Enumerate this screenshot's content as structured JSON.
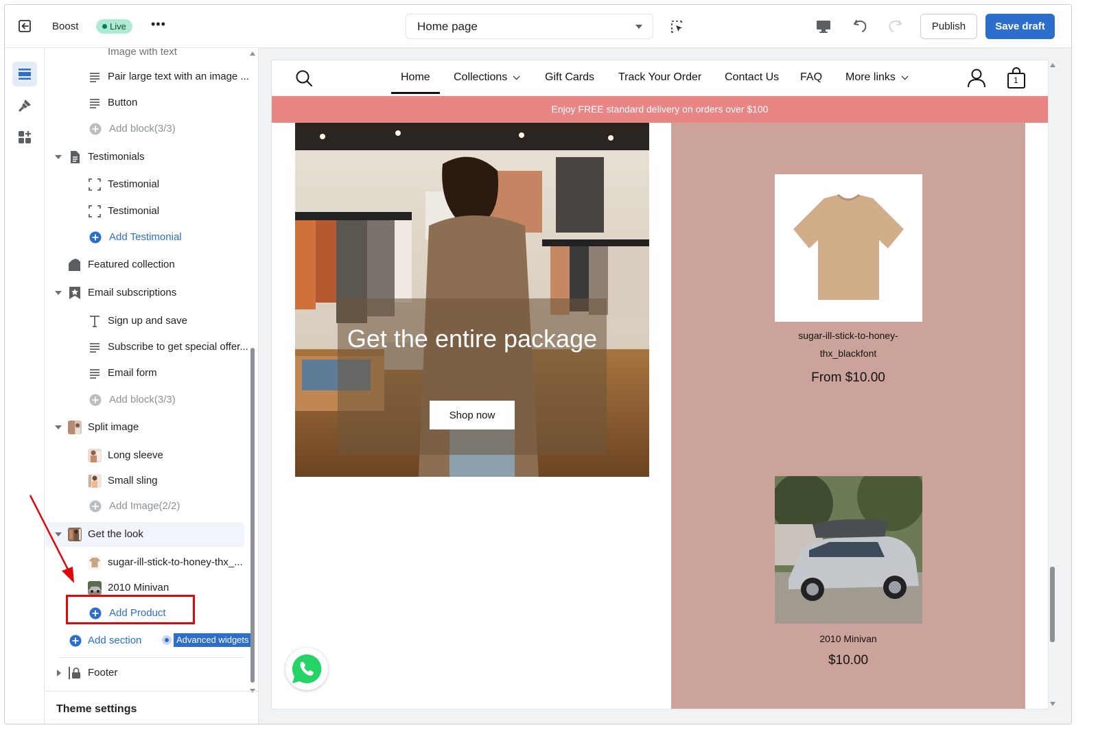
{
  "topbar": {
    "store_name": "Boost",
    "status_badge": "Live",
    "more_label": "•••",
    "page_select": "Home page",
    "publish_label": "Publish",
    "save_label": "Save draft"
  },
  "rail": {
    "items": [
      {
        "name": "sections",
        "icon": "sections-icon",
        "active": true
      },
      {
        "name": "theme-settings",
        "icon": "paint-brush-icon",
        "active": false
      },
      {
        "name": "app-embeds",
        "icon": "apps-icon",
        "active": false
      }
    ]
  },
  "sidebar": {
    "top_partial": "Image with text",
    "rows": {
      "pair_large_text": "Pair large text with an image ...",
      "button": "Button",
      "add_block_1": "Add block(3/3)",
      "testimonials": "Testimonials",
      "testimonial_1": "Testimonial",
      "testimonial_2": "Testimonial",
      "add_testimonial": "Add Testimonial",
      "featured_collection": "Featured collection",
      "email_subscriptions": "Email subscriptions",
      "sign_up": "Sign up and save",
      "subscribe": "Subscribe to get special offer...",
      "email_form": "Email form",
      "add_block_2": "Add block(3/3)",
      "split_image": "Split image",
      "long_sleeve": "Long sleeve",
      "small_sling": "Small sling",
      "add_image": "Add Image(2/2)",
      "get_the_look": "Get the look",
      "product_1": "sugar-ill-stick-to-honey-thx_...",
      "product_2": "2010 Minivan",
      "add_product": "Add Product",
      "add_section": "Add section",
      "advanced_widgets": "Advanced widgets",
      "footer": "Footer"
    },
    "theme_settings": "Theme settings"
  },
  "preview": {
    "nav": {
      "home": "Home",
      "collections": "Collections",
      "gift_cards": "Gift Cards",
      "track_order": "Track Your Order",
      "contact": "Contact Us",
      "faq": "FAQ",
      "more_links": "More links",
      "cart_count": "1"
    },
    "banner": "Enjoy FREE standard delivery on orders over $100",
    "hero": {
      "title": "Get the entire package",
      "button": "Shop now"
    },
    "products": [
      {
        "name": "sugar-ill-stick-to-honey-thx_blackfont",
        "price": "From $10.00"
      },
      {
        "name": "2010 Minivan",
        "price": "$10.00"
      }
    ]
  },
  "colors": {
    "accent": "#2c6ecb",
    "banner": "#e88585",
    "look_panel": "#cca39a",
    "annotation": "#e0060a"
  }
}
